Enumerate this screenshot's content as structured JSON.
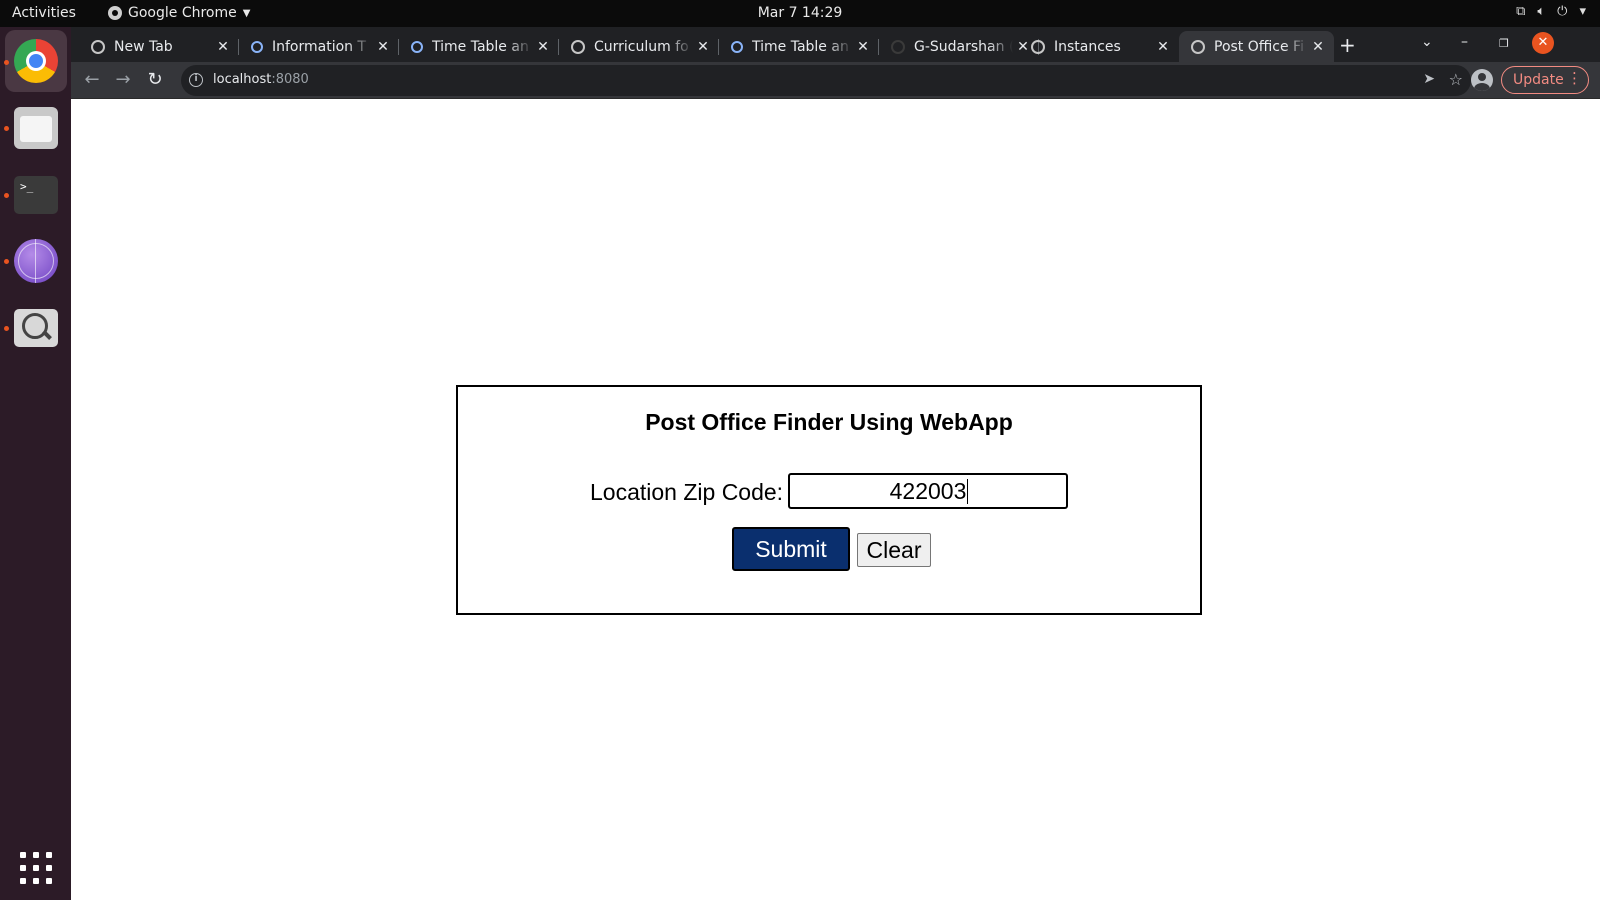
{
  "os_bar": {
    "activities": "Activities",
    "app_name": "Google Chrome",
    "clock": "Mar 7  14:29",
    "icons": [
      "network-icon",
      "volume-icon",
      "power-icon",
      "system-menu-caret-icon"
    ]
  },
  "dock": {
    "items": [
      {
        "name": "chrome",
        "icon": "chrome-icon",
        "running": true
      },
      {
        "name": "files",
        "icon": "files-icon",
        "running": true
      },
      {
        "name": "terminal",
        "icon": "terminal-icon",
        "running": true
      },
      {
        "name": "browser",
        "icon": "globe-icon",
        "running": true
      },
      {
        "name": "search",
        "icon": "magnifier-icon",
        "running": true
      }
    ],
    "apps_button_icon": "apps-grid-icon"
  },
  "browser": {
    "tabs": [
      {
        "label": "New Tab",
        "icon": "chrome-icon",
        "active": false
      },
      {
        "label": "Information T",
        "icon": "loading-ring-icon",
        "active": false
      },
      {
        "label": "Time Table an",
        "icon": "loading-ring-icon",
        "active": false
      },
      {
        "label": "Curriculum fo",
        "icon": "globe-icon",
        "active": false
      },
      {
        "label": "Time Table an",
        "icon": "loading-ring-icon",
        "active": false
      },
      {
        "label": "G-Sudarshan (",
        "icon": "github-icon",
        "active": false
      },
      {
        "label": "Instances",
        "icon": "globe-icon",
        "active": false
      },
      {
        "label": "Post Office Fi",
        "icon": "globe-icon",
        "active": true
      }
    ],
    "new_tab_label": "+",
    "url_host": "localhost",
    "url_port": ":8080",
    "update_label": "Update"
  },
  "page": {
    "title": "Post Office Finder Using WebApp",
    "zip_label": "Location Zip Code:",
    "zip_value": "422003",
    "submit_label": "Submit",
    "clear_label": "Clear",
    "colors": {
      "submit_bg": "#0a2f6e",
      "update_accent": "#f28b82",
      "dock_bg": "#2c1b27"
    }
  }
}
